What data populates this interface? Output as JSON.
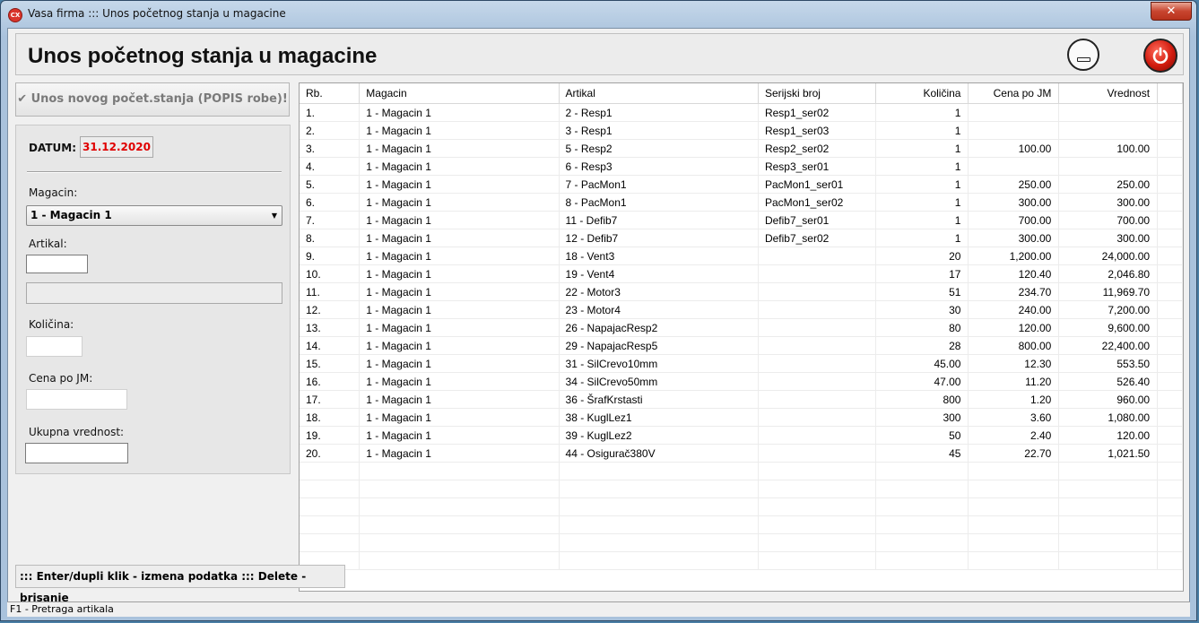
{
  "window": {
    "icon_text": "CX",
    "title": "Vasa firma ::: Unos početnog stanja u magacine",
    "close_symbol": "✕"
  },
  "header": {
    "title": "Unos početnog stanja u magacine"
  },
  "sidebar": {
    "new_button_label": "✔ Unos novog počet.stanja (POPIS robe)!",
    "datum_label": "DATUM:",
    "datum_value": "31.12.2020",
    "magacin_label": "Magacin:",
    "magacin_selected": "1 - Magacin 1",
    "artikal_label": "Artikal:",
    "artikal_value": "",
    "artikal_name": "",
    "kolicina_label": "Količina:",
    "kolicina_value": "",
    "cena_label": "Cena po JM:",
    "cena_value": "",
    "ukupno_label": "Ukupna vrednost:",
    "ukupno_value": ""
  },
  "grid": {
    "columns": [
      "Rb.",
      "Magacin",
      "Artikal",
      "Serijski broj",
      "Količina",
      "Cena po JM",
      "Vrednost"
    ],
    "rows": [
      [
        "1.",
        "1 - Magacin 1",
        "2 - Resp1",
        "Resp1_ser02",
        "1",
        "",
        ""
      ],
      [
        "2.",
        "1 - Magacin 1",
        "3 - Resp1",
        "Resp1_ser03",
        "1",
        "",
        ""
      ],
      [
        "3.",
        "1 - Magacin 1",
        "5 - Resp2",
        "Resp2_ser02",
        "1",
        "100.00",
        "100.00"
      ],
      [
        "4.",
        "1 - Magacin 1",
        "6 - Resp3",
        "Resp3_ser01",
        "1",
        "",
        ""
      ],
      [
        "5.",
        "1 - Magacin 1",
        "7 - PacMon1",
        "PacMon1_ser01",
        "1",
        "250.00",
        "250.00"
      ],
      [
        "6.",
        "1 - Magacin 1",
        "8 - PacMon1",
        "PacMon1_ser02",
        "1",
        "300.00",
        "300.00"
      ],
      [
        "7.",
        "1 - Magacin 1",
        "11 - Defib7",
        "Defib7_ser01",
        "1",
        "700.00",
        "700.00"
      ],
      [
        "8.",
        "1 - Magacin 1",
        "12 - Defib7",
        "Defib7_ser02",
        "1",
        "300.00",
        "300.00"
      ],
      [
        "9.",
        "1 - Magacin 1",
        "18 - Vent3",
        "",
        "20",
        "1,200.00",
        "24,000.00"
      ],
      [
        "10.",
        "1 - Magacin 1",
        "19 - Vent4",
        "",
        "17",
        "120.40",
        "2,046.80"
      ],
      [
        "11.",
        "1 - Magacin 1",
        "22 - Motor3",
        "",
        "51",
        "234.70",
        "11,969.70"
      ],
      [
        "12.",
        "1 - Magacin 1",
        "23 - Motor4",
        "",
        "30",
        "240.00",
        "7,200.00"
      ],
      [
        "13.",
        "1 - Magacin 1",
        "26 - NapajacResp2",
        "",
        "80",
        "120.00",
        "9,600.00"
      ],
      [
        "14.",
        "1 - Magacin 1",
        "29 - NapajacResp5",
        "",
        "28",
        "800.00",
        "22,400.00"
      ],
      [
        "15.",
        "1 - Magacin 1",
        "31 - SilCrevo10mm",
        "",
        "45.00",
        "12.30",
        "553.50"
      ],
      [
        "16.",
        "1 - Magacin 1",
        "34 - SilCrevo50mm",
        "",
        "47.00",
        "11.20",
        "526.40"
      ],
      [
        "17.",
        "1 - Magacin 1",
        "36 - ŠrafKrstasti",
        "",
        "800",
        "1.20",
        "960.00"
      ],
      [
        "18.",
        "1 - Magacin 1",
        "38 - KuglLez1",
        "",
        "300",
        "3.60",
        "1,080.00"
      ],
      [
        "19.",
        "1 - Magacin 1",
        "39 - KuglLez2",
        "",
        "50",
        "2.40",
        "120.00"
      ],
      [
        "20.",
        "1 - Magacin 1",
        "44 - Osigurač380V",
        "",
        "45",
        "22.70",
        "1,021.50"
      ]
    ]
  },
  "hint_bar": {
    "text": "::: Enter/dupli klik - izmena podatka ::: Delete - brisanje"
  },
  "status_bar": {
    "text": "F1 - Pretraga artikala"
  }
}
